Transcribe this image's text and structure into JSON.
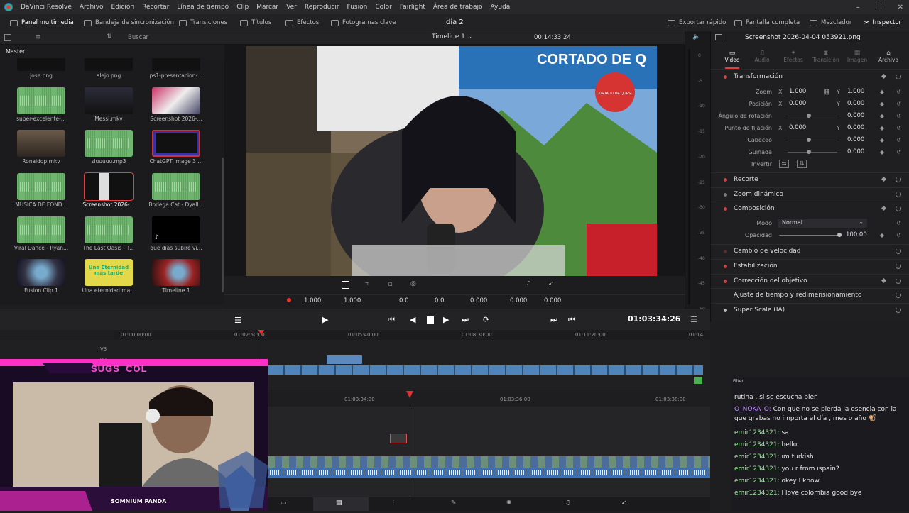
{
  "app": {
    "name": "DaVinci Resolve",
    "menu": [
      "Archivo",
      "Edición",
      "Recortar",
      "Línea de tiempo",
      "Clip",
      "Marcar",
      "Ver",
      "Reproducir",
      "Fusion",
      "Color",
      "Fairlight",
      "Área de trabajo",
      "Ayuda"
    ]
  },
  "toolbar": {
    "media_pool": "Panel multimedia",
    "sync_bin": "Bandeja de sincronización",
    "transitions": "Transiciones",
    "titles": "Títulos",
    "effects": "Efectos",
    "keyframes": "Fotogramas clave",
    "project": "dia 2",
    "export": "Exportar rápido",
    "fullscreen": "Pantalla completa",
    "mixer": "Mezclador",
    "inspector": "Inspector"
  },
  "media_pool": {
    "search_placeholder": "Buscar",
    "bin": "Master",
    "clips": [
      {
        "label": "jose.png"
      },
      {
        "label": "alejo.png"
      },
      {
        "label": "ps1-presentacion-..."
      },
      {
        "label": "super-excelente-..."
      },
      {
        "label": "Messi.mkv"
      },
      {
        "label": "Screenshot 2026-..."
      },
      {
        "label": "Ronaldop.mkv"
      },
      {
        "label": "siuuuuu.mp3"
      },
      {
        "label": "ChatGPT Image 3 ..."
      },
      {
        "label": "MUSICA DE FOND..."
      },
      {
        "label": "Screenshot 2026-..."
      },
      {
        "label": "Bodega Cat - Dyall..."
      },
      {
        "label": "Viral Dance - Ryan..."
      },
      {
        "label": "The Last Oasis - T..."
      },
      {
        "label": "que dias subiré vi..."
      },
      {
        "label": "Fusion Clip 1"
      },
      {
        "label": "Una eternidad ma..."
      },
      {
        "label": "Timeline 1"
      }
    ],
    "thumb_text_16": "Una Eternidad más tarde"
  },
  "viewer": {
    "timeline_name": "Timeline 1",
    "timecode_top": "00:14:33:24",
    "banner_text": "CORTADO DE Q",
    "logo_text": "CORTADO DE QUESO",
    "stats": {
      "zoom_x": "1.000",
      "zoom_y": "1.000",
      "pos_x": "0.0",
      "pos_y": "0.0",
      "rot": "0.000",
      "pitch": "0.000",
      "yaw": "0.000"
    }
  },
  "meter_ticks": [
    "0",
    "-5",
    "-10",
    "-15",
    "-20",
    "-25",
    "-30",
    "-35",
    "-40",
    "-45",
    "-50"
  ],
  "inspector": {
    "clip_name": "Screenshot 2026-04-04 053921.png",
    "tabs": [
      "Video",
      "Audio",
      "Efectos",
      "Transición",
      "Imagen",
      "Archivo"
    ],
    "transform_title": "Transformación",
    "zoom": {
      "label": "Zoom",
      "x": "1.000",
      "y": "1.000"
    },
    "position": {
      "label": "Posición",
      "x": "0.000",
      "y": "0.000"
    },
    "rotation": {
      "label": "Ángulo de rotación",
      "value": "0.000"
    },
    "anchor": {
      "label": "Punto de fijación",
      "x": "0.000",
      "y": "0.000"
    },
    "pitch": {
      "label": "Cabeceo",
      "value": "0.000"
    },
    "yaw": {
      "label": "Guiñada",
      "value": "0.000"
    },
    "flip": {
      "label": "Invertir"
    },
    "sections": [
      "Recorte",
      "Zoom dinámico",
      "Composición"
    ],
    "mode": {
      "label": "Modo",
      "value": "Normal"
    },
    "opacity": {
      "label": "Opacidad",
      "value": "100.00"
    },
    "more_sections": [
      "Cambio de velocidad",
      "Estabilización",
      "Corrección del objetivo",
      "Ajuste de tiempo y redimensionamiento",
      "Super Scale (IA)"
    ]
  },
  "timeline": {
    "timecode": "01:03:34:26",
    "ruler_upper": [
      "01:00:00:00",
      "01:02:50:00",
      "01:05:40:00",
      "01:08:30:00",
      "01:11:20:00",
      "01:14"
    ],
    "ruler_lower": [
      "01:03:34:00",
      "01:03:36:00",
      "01:03:38:00"
    ],
    "tracks": [
      "V3",
      "V2"
    ]
  },
  "stream": {
    "channel": "SUGS_COL",
    "footer": "SOMNIUM PANDA",
    "chat_filter": "Filter",
    "chat": [
      {
        "user": "",
        "text": "rutina , si se escucha bien"
      },
      {
        "user": "O_NOKA_O:",
        "text": " Con que no se pierda la esencia con la que grabas no importa el día , mes o año 🐒"
      },
      {
        "user": "emir1234321:",
        "text": " sa"
      },
      {
        "user": "emir1234321:",
        "text": " hello"
      },
      {
        "user": "emir1234321:",
        "text": " ım turkish"
      },
      {
        "user": "emir1234321:",
        "text": " you r from ıspain?"
      },
      {
        "user": "emir1234321:",
        "text": " okey I know"
      },
      {
        "user": "emir1234321:",
        "text": " I love colombia good bye"
      }
    ]
  }
}
